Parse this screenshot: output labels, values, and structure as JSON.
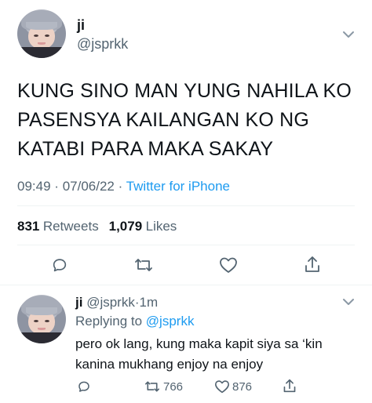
{
  "tweet": {
    "name": "ji",
    "handle": "@jsprkk",
    "text_lines": [
      "KUNG SINO MAN YUNG NAHILA KO",
      "PASENSYA KAILANGAN KO NG",
      "KATABI PARA MAKA SAKAY"
    ],
    "time": "09:49",
    "date": "07/06/22",
    "separator": "·",
    "source": "Twitter for iPhone",
    "retweets_count": "831",
    "retweets_label": "Retweets",
    "likes_count": "1,079",
    "likes_label": "Likes"
  },
  "reply": {
    "name": "ji",
    "handle": "@jsprkk",
    "separator": "·",
    "age": "1m",
    "replying_prefix": "Replying to",
    "replying_to": "@jsprkk",
    "text_lines": [
      "pero ok lang, kung maka kapit siya sa ‘kin",
      "kanina mukhang enjoy na enjoy"
    ],
    "retweets_count": "766",
    "likes_count": "876"
  },
  "icons": {
    "reply": "reply-icon",
    "retweet": "retweet-icon",
    "like": "heart-icon",
    "share": "share-icon",
    "menu": "chevron-down-icon"
  },
  "colors": {
    "text": "#0f1419",
    "secondary": "#536471",
    "accent": "#1d9bf0",
    "divider": "#eff3f4"
  }
}
